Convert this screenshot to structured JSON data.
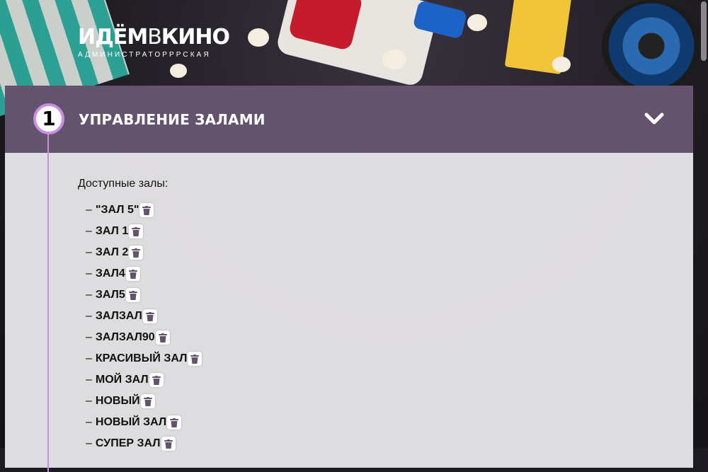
{
  "header": {
    "logo_part1": "ИДЁМ",
    "logo_part2": "В",
    "logo_part3": "КИНО",
    "subtitle": "АДМИНИСТРАТОРРРСКАЯ"
  },
  "section": {
    "step_number": "1",
    "title": "УПРАВЛЕНИЕ ЗАЛАМИ",
    "toggle_icon": "chevron-down-icon"
  },
  "halls": {
    "label": "Доступные залы:",
    "dash": "–",
    "delete_icon": "trash-icon",
    "items": [
      {
        "name": "\"ЗАЛ 5\""
      },
      {
        "name": "ЗАЛ 1"
      },
      {
        "name": "ЗАЛ 2"
      },
      {
        "name": "ЗАЛ4"
      },
      {
        "name": "ЗАЛ5"
      },
      {
        "name": "ЗАЛЗАЛ"
      },
      {
        "name": "ЗАЛЗАЛ90"
      },
      {
        "name": "КРАСИВЫЙ ЗАЛ"
      },
      {
        "name": "МОЙ ЗАЛ"
      },
      {
        "name": "НОВЫЙ"
      },
      {
        "name": "НОВЫЙ ЗАЛ"
      },
      {
        "name": "СУПЕР ЗАЛ"
      }
    ]
  },
  "colors": {
    "header_bg": "#63536c",
    "accent": "#c98fe2",
    "trash_icon": "#63536c"
  }
}
